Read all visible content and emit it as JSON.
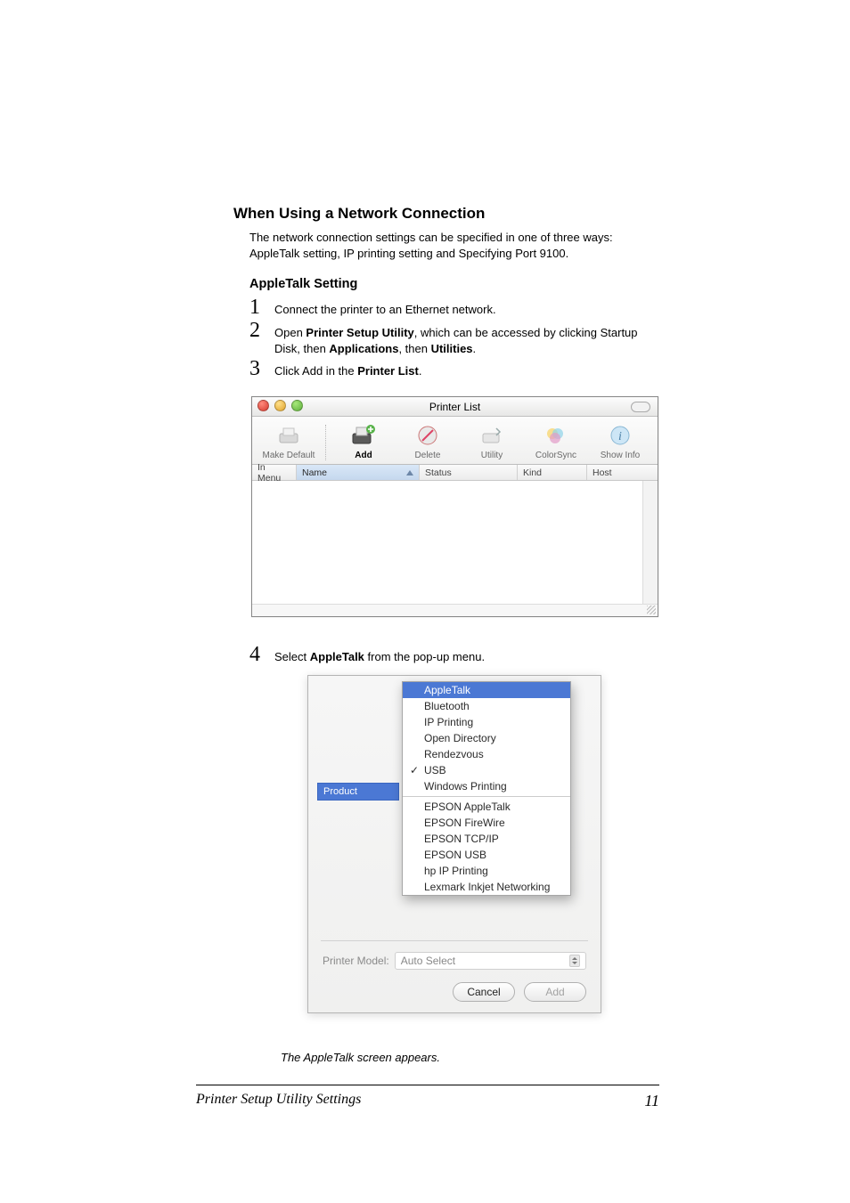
{
  "section": {
    "title": "When Using a Network Connection"
  },
  "intro": {
    "line1": "The network connection settings can be specified in one of three ways:",
    "line2": "AppleTalk setting, IP printing setting and Specifying Port 9100."
  },
  "subheading": "AppleTalk Setting",
  "steps": {
    "s1": {
      "num": "1",
      "text": "Connect the printer to an Ethernet network."
    },
    "s2": {
      "num": "2",
      "pre": "Open ",
      "b1": "Printer Setup Utility",
      "mid1": ", which can be accessed by clicking Startup Disk, then ",
      "b2": "Applications",
      "mid2": ", then ",
      "b3": "Utilities",
      "post": "."
    },
    "s3": {
      "num": "3",
      "pre": "Click Add in the ",
      "b1": "Printer List",
      "post": "."
    },
    "s4": {
      "num": "4",
      "pre": "Select ",
      "b1": "AppleTalk",
      "post": " from the pop-up menu."
    }
  },
  "printerList": {
    "title": "Printer List",
    "toolbar": {
      "makeDefault": "Make Default",
      "add": "Add",
      "delete": "Delete",
      "utility": "Utility",
      "colorSync": "ColorSync",
      "showInfo": "Show Info"
    },
    "columns": {
      "inMenu": "In Menu",
      "name": "Name",
      "status": "Status",
      "kind": "Kind",
      "host": "Host"
    }
  },
  "popup": {
    "items": {
      "appletalk": "AppleTalk",
      "bluetooth": "Bluetooth",
      "ipprinting": "IP Printing",
      "opendir": "Open Directory",
      "rendezvous": "Rendezvous",
      "usb": "USB",
      "winprint": "Windows Printing",
      "epAppletalk": "EPSON AppleTalk",
      "epFirewire": "EPSON FireWire",
      "epTcp": "EPSON TCP/IP",
      "epUsb": "EPSON USB",
      "hpIp": "hp IP Printing",
      "lexmark": "Lexmark Inkjet Networking"
    },
    "sideLabel": "Product",
    "printerModelLabel": "Printer Model:",
    "printerModelValue": "Auto Select",
    "cancel": "Cancel",
    "add": "Add"
  },
  "caption": "The AppleTalk screen appears.",
  "footer": {
    "left": "Printer Setup Utility Settings",
    "page": "11"
  }
}
